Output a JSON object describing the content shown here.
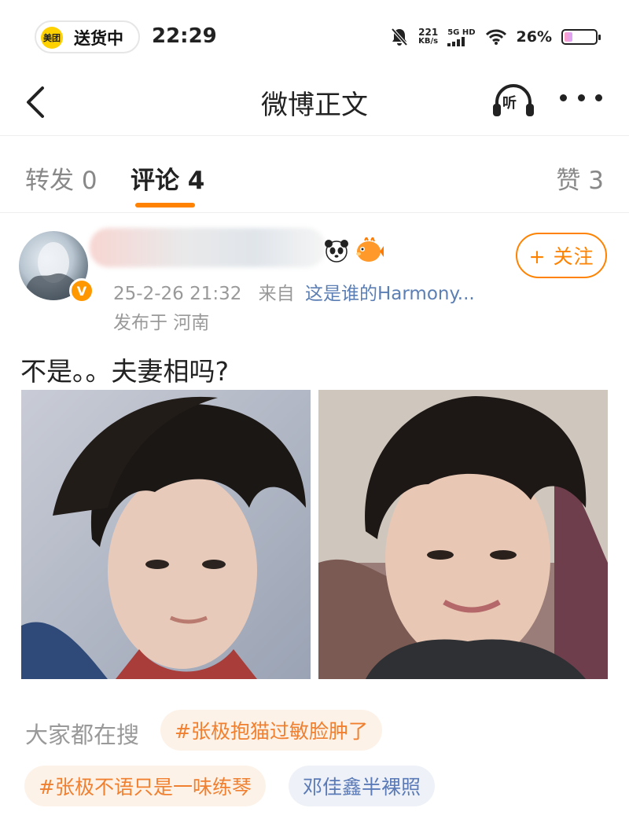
{
  "status_bar": {
    "app_pill_logo": "美团",
    "app_pill_text": "送货中",
    "time": "22:29",
    "net_speed_value": "221",
    "net_speed_unit": "KB/s",
    "signal_label": "5G HD",
    "battery_percent": "26%",
    "battery_level": 0.26,
    "icons": [
      "mute-icon",
      "signal-icon",
      "wifi-icon",
      "battery-icon"
    ]
  },
  "nav": {
    "title": "微博正文",
    "listen_label": "听"
  },
  "tabs": {
    "repost": "转发 0",
    "comment": "评论 4",
    "like": "赞 3"
  },
  "post": {
    "follow_label": "+ 关注",
    "time": "25-2-26 21:32",
    "from_label": "来自",
    "source": "这是谁的Harmony...",
    "location": "发布于 河南",
    "text": "不是。。夫妻相吗?"
  },
  "hot_search": {
    "label": "大家都在搜",
    "items": [
      "#张极抱猫过敏脸肿了",
      "#张极不语只是一味练琴",
      "邓佳鑫半裸照"
    ]
  },
  "colors": {
    "accent": "#ff8200",
    "link": "#5b7fb5",
    "muted": "#999999"
  }
}
